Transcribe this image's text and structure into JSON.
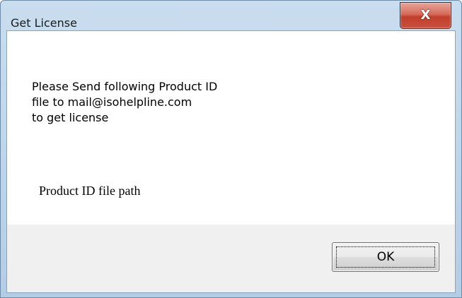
{
  "window": {
    "title": "Get License",
    "close_label": "X"
  },
  "message": {
    "lines": [
      "Please Send following Product ID",
      "file to mail@isohelpline.com",
      "to get license"
    ]
  },
  "product_id_label": "Product ID file path",
  "buttons": {
    "ok_label": "OK"
  },
  "colors": {
    "close_button": "#c9503f",
    "footer_background": "#f0f0f0",
    "frame": "#b4cde6"
  }
}
